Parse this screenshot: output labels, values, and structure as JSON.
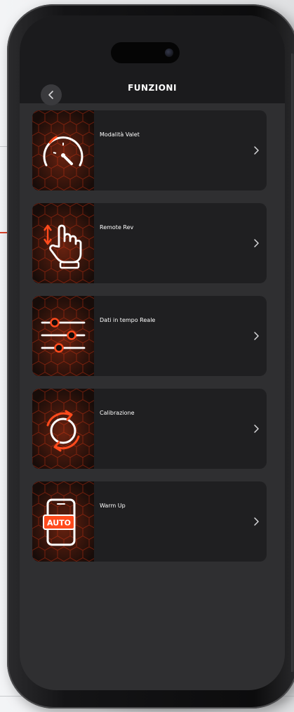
{
  "header": {
    "title": "FUNZIONI",
    "back_icon": "chevron-left-icon"
  },
  "menu": {
    "items": [
      {
        "label": "Modalità Valet",
        "icon": "speedometer-icon"
      },
      {
        "label": "Remote Rev",
        "icon": "hand-pointer-icon"
      },
      {
        "label": "Dati in tempo Reale",
        "icon": "sliders-icon"
      },
      {
        "label": "Calibrazione",
        "icon": "refresh-circle-icon"
      },
      {
        "label": "Warm Up",
        "icon": "phone-auto-icon",
        "badge": "AUTO"
      }
    ]
  },
  "colors": {
    "accent": "#ff4a1c",
    "card": "#1f1f21",
    "screen": "#2f2f31",
    "header": "#1b1b1d",
    "thumb_bg": "#170c09"
  }
}
